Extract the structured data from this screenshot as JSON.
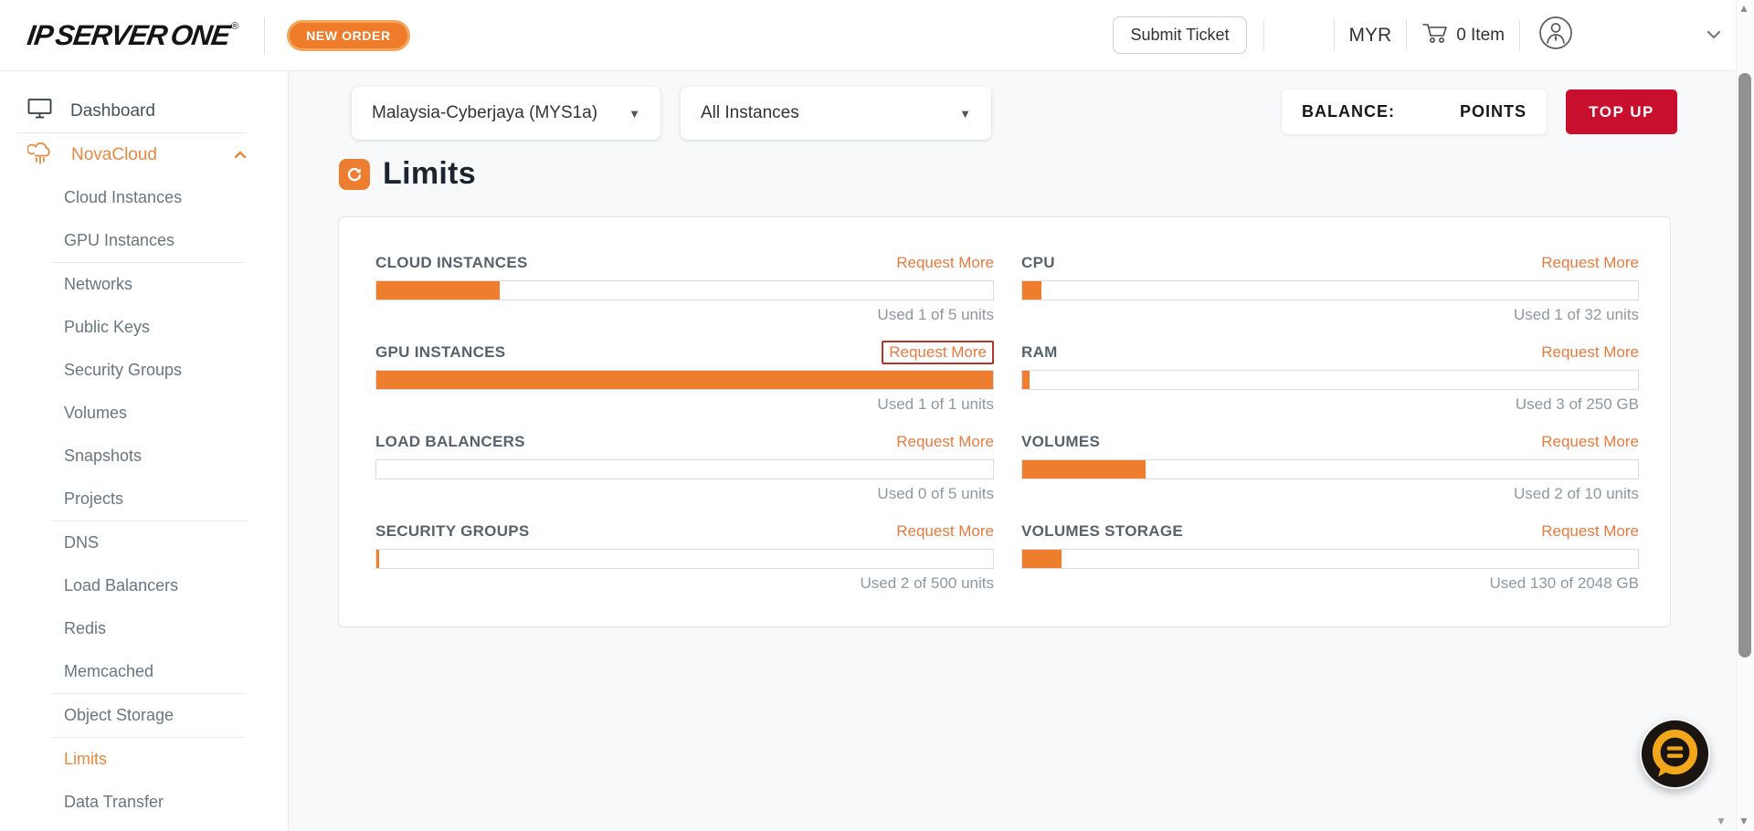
{
  "header": {
    "logo_text": "IP SERVER ONE",
    "logo_reg": "®",
    "new_order_label": "NEW ORDER",
    "submit_ticket_label": "Submit Ticket",
    "currency": "MYR",
    "cart_count": "0 Item"
  },
  "sidebar": {
    "items": [
      {
        "label": "Dashboard"
      },
      {
        "label": "NovaCloud"
      },
      {
        "label": "Cloud Instances"
      },
      {
        "label": "GPU Instances"
      },
      {
        "label": "Networks"
      },
      {
        "label": "Public Keys"
      },
      {
        "label": "Security Groups"
      },
      {
        "label": "Volumes"
      },
      {
        "label": "Snapshots"
      },
      {
        "label": "Projects"
      },
      {
        "label": "DNS"
      },
      {
        "label": "Load Balancers"
      },
      {
        "label": "Redis"
      },
      {
        "label": "Memcached"
      },
      {
        "label": "Object Storage"
      },
      {
        "label": "Limits"
      },
      {
        "label": "Data Transfer"
      }
    ],
    "active_item": "Limits",
    "expanded_section": "NovaCloud"
  },
  "filters": {
    "region": "Malaysia-Cyberjaya (MYS1a)",
    "instances": "All Instances"
  },
  "balance": {
    "label": "BALANCE:",
    "points_label": "POINTS",
    "topup_label": "TOP UP"
  },
  "page": {
    "title": "Limits"
  },
  "limits": {
    "request_more_label": "Request More",
    "items": [
      {
        "label": "CLOUD INSTANCES",
        "used": 1,
        "total": 5,
        "used_text": "Used 1 of 5 units",
        "highlighted": false
      },
      {
        "label": "CPU",
        "used": 1,
        "total": 32,
        "used_text": "Used 1 of 32 units",
        "highlighted": false
      },
      {
        "label": "GPU INSTANCES",
        "used": 1,
        "total": 1,
        "used_text": "Used 1 of 1 units",
        "highlighted": true
      },
      {
        "label": "RAM",
        "used": 3,
        "total": 250,
        "used_text": "Used 3 of 250 GB",
        "highlighted": false
      },
      {
        "label": "LOAD BALANCERS",
        "used": 0,
        "total": 5,
        "used_text": "Used 0 of 5 units",
        "highlighted": false
      },
      {
        "label": "VOLUMES",
        "used": 2,
        "total": 10,
        "used_text": "Used 2 of 10 units",
        "highlighted": false
      },
      {
        "label": "SECURITY GROUPS",
        "used": 2,
        "total": 500,
        "used_text": "Used 2 of 500 units",
        "highlighted": false
      },
      {
        "label": "VOLUMES STORAGE",
        "used": 130,
        "total": 2048,
        "used_text": "Used 130 of 2048 GB",
        "highlighted": false
      }
    ]
  },
  "icons": {
    "caret_down": "▼",
    "scroll_up": "▲",
    "scroll_down": "▼"
  },
  "colors": {
    "accent_orange": "#ED7D31",
    "request_more_orange": "#E87A3E",
    "active_link_orange": "#E8873C",
    "new_order_orange": "#EE7C2B",
    "topup_red": "#C8102E",
    "highlight_border_red": "#B3362B",
    "chat_yellow": "#F2A71B",
    "chat_black": "#1A1511"
  }
}
